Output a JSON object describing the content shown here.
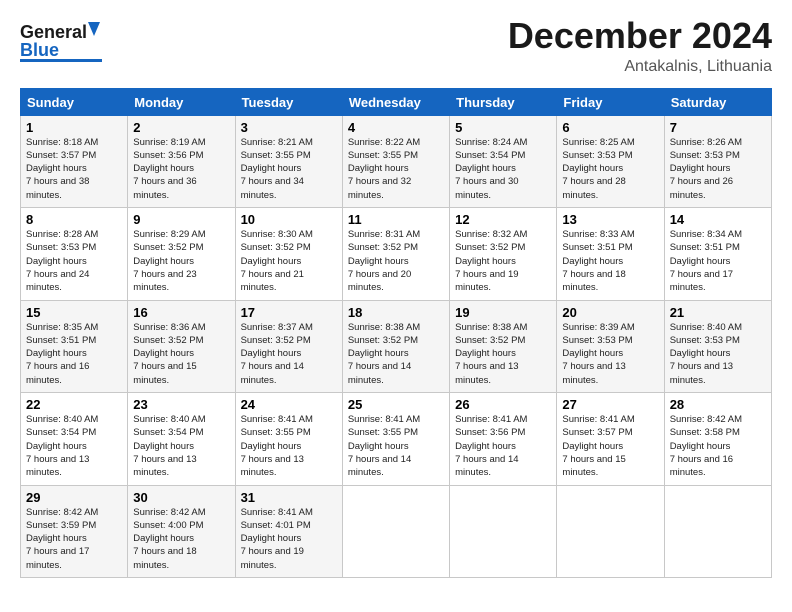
{
  "header": {
    "logo_line1": "General",
    "logo_line2": "Blue",
    "month": "December 2024",
    "location": "Antakalnis, Lithuania"
  },
  "weekdays": [
    "Sunday",
    "Monday",
    "Tuesday",
    "Wednesday",
    "Thursday",
    "Friday",
    "Saturday"
  ],
  "weeks": [
    [
      {
        "day": "1",
        "sunrise": "8:18 AM",
        "sunset": "3:57 PM",
        "daylight": "7 hours and 38 minutes."
      },
      {
        "day": "2",
        "sunrise": "8:19 AM",
        "sunset": "3:56 PM",
        "daylight": "7 hours and 36 minutes."
      },
      {
        "day": "3",
        "sunrise": "8:21 AM",
        "sunset": "3:55 PM",
        "daylight": "7 hours and 34 minutes."
      },
      {
        "day": "4",
        "sunrise": "8:22 AM",
        "sunset": "3:55 PM",
        "daylight": "7 hours and 32 minutes."
      },
      {
        "day": "5",
        "sunrise": "8:24 AM",
        "sunset": "3:54 PM",
        "daylight": "7 hours and 30 minutes."
      },
      {
        "day": "6",
        "sunrise": "8:25 AM",
        "sunset": "3:53 PM",
        "daylight": "7 hours and 28 minutes."
      },
      {
        "day": "7",
        "sunrise": "8:26 AM",
        "sunset": "3:53 PM",
        "daylight": "7 hours and 26 minutes."
      }
    ],
    [
      {
        "day": "8",
        "sunrise": "8:28 AM",
        "sunset": "3:53 PM",
        "daylight": "7 hours and 24 minutes."
      },
      {
        "day": "9",
        "sunrise": "8:29 AM",
        "sunset": "3:52 PM",
        "daylight": "7 hours and 23 minutes."
      },
      {
        "day": "10",
        "sunrise": "8:30 AM",
        "sunset": "3:52 PM",
        "daylight": "7 hours and 21 minutes."
      },
      {
        "day": "11",
        "sunrise": "8:31 AM",
        "sunset": "3:52 PM",
        "daylight": "7 hours and 20 minutes."
      },
      {
        "day": "12",
        "sunrise": "8:32 AM",
        "sunset": "3:52 PM",
        "daylight": "7 hours and 19 minutes."
      },
      {
        "day": "13",
        "sunrise": "8:33 AM",
        "sunset": "3:51 PM",
        "daylight": "7 hours and 18 minutes."
      },
      {
        "day": "14",
        "sunrise": "8:34 AM",
        "sunset": "3:51 PM",
        "daylight": "7 hours and 17 minutes."
      }
    ],
    [
      {
        "day": "15",
        "sunrise": "8:35 AM",
        "sunset": "3:51 PM",
        "daylight": "7 hours and 16 minutes."
      },
      {
        "day": "16",
        "sunrise": "8:36 AM",
        "sunset": "3:52 PM",
        "daylight": "7 hours and 15 minutes."
      },
      {
        "day": "17",
        "sunrise": "8:37 AM",
        "sunset": "3:52 PM",
        "daylight": "7 hours and 14 minutes."
      },
      {
        "day": "18",
        "sunrise": "8:38 AM",
        "sunset": "3:52 PM",
        "daylight": "7 hours and 14 minutes."
      },
      {
        "day": "19",
        "sunrise": "8:38 AM",
        "sunset": "3:52 PM",
        "daylight": "7 hours and 13 minutes."
      },
      {
        "day": "20",
        "sunrise": "8:39 AM",
        "sunset": "3:53 PM",
        "daylight": "7 hours and 13 minutes."
      },
      {
        "day": "21",
        "sunrise": "8:40 AM",
        "sunset": "3:53 PM",
        "daylight": "7 hours and 13 minutes."
      }
    ],
    [
      {
        "day": "22",
        "sunrise": "8:40 AM",
        "sunset": "3:54 PM",
        "daylight": "7 hours and 13 minutes."
      },
      {
        "day": "23",
        "sunrise": "8:40 AM",
        "sunset": "3:54 PM",
        "daylight": "7 hours and 13 minutes."
      },
      {
        "day": "24",
        "sunrise": "8:41 AM",
        "sunset": "3:55 PM",
        "daylight": "7 hours and 13 minutes."
      },
      {
        "day": "25",
        "sunrise": "8:41 AM",
        "sunset": "3:55 PM",
        "daylight": "7 hours and 14 minutes."
      },
      {
        "day": "26",
        "sunrise": "8:41 AM",
        "sunset": "3:56 PM",
        "daylight": "7 hours and 14 minutes."
      },
      {
        "day": "27",
        "sunrise": "8:41 AM",
        "sunset": "3:57 PM",
        "daylight": "7 hours and 15 minutes."
      },
      {
        "day": "28",
        "sunrise": "8:42 AM",
        "sunset": "3:58 PM",
        "daylight": "7 hours and 16 minutes."
      }
    ],
    [
      {
        "day": "29",
        "sunrise": "8:42 AM",
        "sunset": "3:59 PM",
        "daylight": "7 hours and 17 minutes."
      },
      {
        "day": "30",
        "sunrise": "8:42 AM",
        "sunset": "4:00 PM",
        "daylight": "7 hours and 18 minutes."
      },
      {
        "day": "31",
        "sunrise": "8:41 AM",
        "sunset": "4:01 PM",
        "daylight": "7 hours and 19 minutes."
      },
      null,
      null,
      null,
      null
    ]
  ]
}
